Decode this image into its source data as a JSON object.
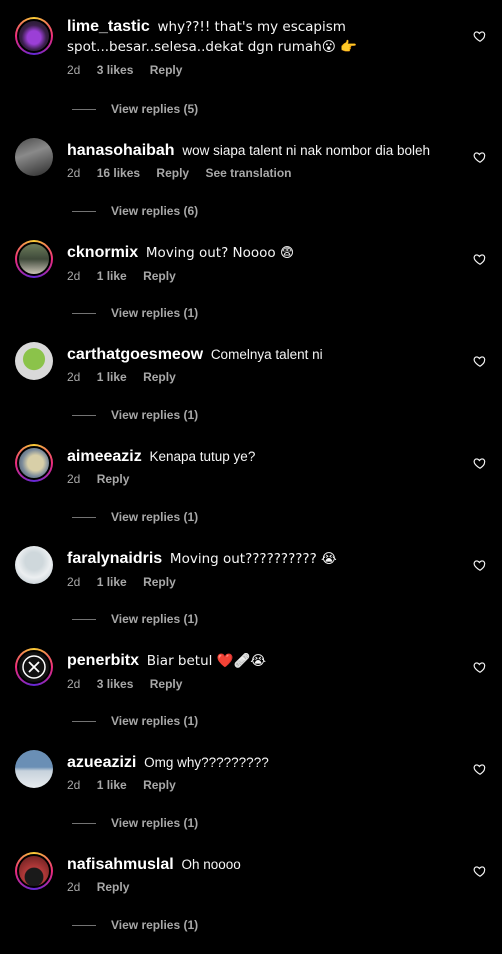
{
  "comments": [
    {
      "username": "lime_tastic",
      "text": "why??!! that's my escapism spot...besar..selesa..dekat dgn rumah😮 👉",
      "time": "2d",
      "likes": "3 likes",
      "reply": "Reply",
      "translate": "",
      "view_replies": "View replies (5)"
    },
    {
      "username": "hanasohaibah",
      "text": "wow siapa talent ni nak nombor dia boleh",
      "time": "2d",
      "likes": "16 likes",
      "reply": "Reply",
      "translate": "See translation",
      "view_replies": "View replies (6)"
    },
    {
      "username": "cknormix",
      "text": "Moving out? Noooo 😨",
      "time": "2d",
      "likes": "1 like",
      "reply": "Reply",
      "translate": "",
      "view_replies": "View replies (1)"
    },
    {
      "username": "carthatgoesmeow",
      "text": "Comelnya talent ni",
      "time": "2d",
      "likes": "1 like",
      "reply": "Reply",
      "translate": "",
      "view_replies": "View replies (1)"
    },
    {
      "username": "aimeeaziz",
      "text": "Kenapa tutup ye?",
      "time": "2d",
      "likes": "",
      "reply": "Reply",
      "translate": "",
      "view_replies": "View replies (1)"
    },
    {
      "username": "faralynaidris",
      "text": "Moving out?????????? 😭",
      "time": "2d",
      "likes": "1 like",
      "reply": "Reply",
      "translate": "",
      "view_replies": "View replies (1)"
    },
    {
      "username": "penerbitx",
      "text": "Biar betul ❤️🩹😭",
      "time": "2d",
      "likes": "3 likes",
      "reply": "Reply",
      "translate": "",
      "view_replies": "View replies (1)"
    },
    {
      "username": "azueazizi",
      "text": "Omg why?????????",
      "time": "2d",
      "likes": "1 like",
      "reply": "Reply",
      "translate": "",
      "view_replies": "View replies (1)"
    },
    {
      "username": "nafisahmuslal",
      "text": "Oh noooo",
      "time": "2d",
      "likes": "",
      "reply": "Reply",
      "translate": "",
      "view_replies": "View replies (1)"
    }
  ],
  "colors": {
    "background": "#000000",
    "text_primary": "#f5f5f5",
    "text_secondary": "#a8a8a8"
  },
  "icons": {
    "like": "heart-outline-icon"
  }
}
